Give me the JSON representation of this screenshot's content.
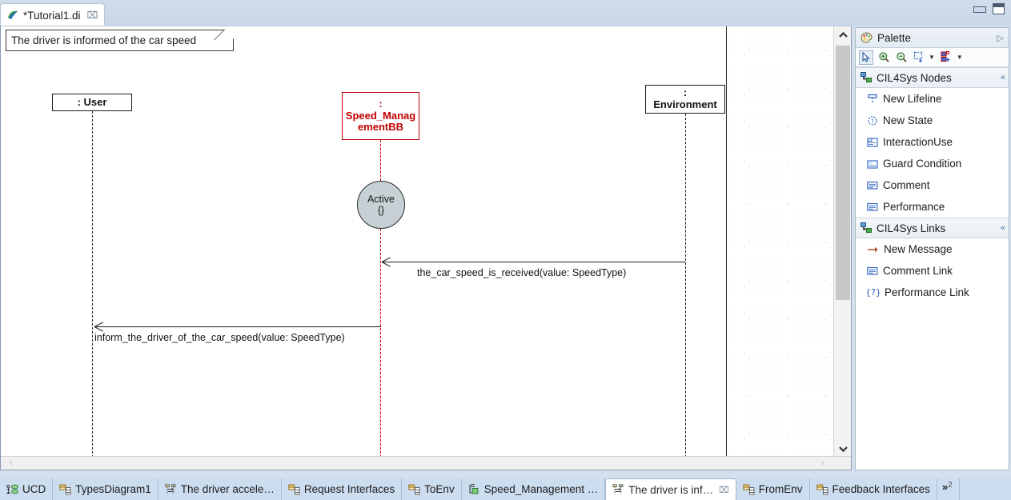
{
  "window": {
    "minimize_label": "Minimize",
    "maximize_label": "Maximize"
  },
  "editor_tab": {
    "title": "*Tutorial1.di",
    "close_glyph": "⌧",
    "icon": "papyrus-diagram-icon"
  },
  "diagram": {
    "note": {
      "text": "The driver is informed of the car speed"
    },
    "lifelines": [
      {
        "name": "user",
        "label": ": User",
        "color": "#1a1a1a"
      },
      {
        "name": "speed-management-bb",
        "label": ":\nSpeed_Manag\nementBB",
        "line1": ":",
        "line2": "Speed_Manag",
        "line3": "ementBB",
        "color": "#c00000"
      },
      {
        "name": "environment",
        "label": ":\nEnvironment",
        "line1": ":",
        "line2": "Environment",
        "color": "#1a1a1a"
      }
    ],
    "state": {
      "label": "Active",
      "sublabel": "{}"
    },
    "messages": [
      {
        "name": "the-car-speed-is-received",
        "label": "the_car_speed_is_received(value: SpeedType)",
        "direction": "right-to-left"
      },
      {
        "name": "inform-the-driver-of-the-car-speed",
        "label": "inform_the_driver_of_the_car_speed(value: SpeedType)",
        "direction": "right-to-left"
      }
    ]
  },
  "palette": {
    "title": "Palette",
    "collapse_glyph": "▷",
    "toolbar": [
      {
        "name": "select-tool",
        "icon": "arrow-cursor-icon",
        "selected": true
      },
      {
        "name": "zoom-in-tool",
        "icon": "zoom-in-icon",
        "selected": false
      },
      {
        "name": "zoom-out-tool",
        "icon": "zoom-out-icon",
        "selected": false
      },
      {
        "name": "marquee-tool",
        "icon": "marquee-select-icon",
        "selected": false,
        "has_dropdown": true
      },
      {
        "name": "format-tool",
        "icon": "node-create-icon",
        "selected": false,
        "has_dropdown": true
      }
    ],
    "groups": [
      {
        "name": "cil4sys-nodes",
        "label": "CIL4Sys Nodes",
        "icon": "group-nodes-icon",
        "pin_glyph": "«",
        "items": [
          {
            "name": "new-lifeline",
            "label": "New Lifeline",
            "icon": "lifeline-icon"
          },
          {
            "name": "new-state",
            "label": "New State",
            "icon": "state-icon"
          },
          {
            "name": "interaction-use",
            "label": "InteractionUse",
            "icon": "interaction-use-icon"
          },
          {
            "name": "guard-condition",
            "label": "Guard Condition",
            "icon": "guard-condition-icon"
          },
          {
            "name": "comment",
            "label": "Comment",
            "icon": "comment-icon"
          },
          {
            "name": "performance",
            "label": "Performance",
            "icon": "comment-icon"
          }
        ]
      },
      {
        "name": "cil4sys-links",
        "label": "CIL4Sys Links",
        "icon": "group-links-icon",
        "pin_glyph": "«",
        "items": [
          {
            "name": "new-message",
            "label": "New Message",
            "icon": "arrow-right-icon"
          },
          {
            "name": "comment-link",
            "label": "Comment Link",
            "icon": "comment-icon"
          },
          {
            "name": "performance-link",
            "label": "Performance Link",
            "icon": "brace-question-icon"
          }
        ]
      }
    ]
  },
  "bottom_tabs": {
    "items": [
      {
        "name": "tab-ucd",
        "label": "UCD",
        "icon": "usecase-diagram-icon",
        "active": false,
        "closable": false
      },
      {
        "name": "tab-typesdiagram1",
        "label": "TypesDiagram1",
        "icon": "class-diagram-icon",
        "active": false,
        "closable": false
      },
      {
        "name": "tab-the-driver-accelerates",
        "label": "The driver accele…",
        "icon": "sequence-diagram-icon",
        "active": false,
        "closable": false
      },
      {
        "name": "tab-request-interfaces",
        "label": "Request Interfaces",
        "icon": "class-diagram-icon",
        "active": false,
        "closable": false
      },
      {
        "name": "tab-toenv",
        "label": "ToEnv",
        "icon": "class-diagram-icon",
        "active": false,
        "closable": false
      },
      {
        "name": "tab-speed-management",
        "label": "Speed_Management …",
        "icon": "composite-diagram-icon",
        "active": false,
        "closable": false
      },
      {
        "name": "tab-the-driver-is-informed",
        "label": "The driver is inf…",
        "icon": "sequence-diagram-icon",
        "active": true,
        "closable": true,
        "close_glyph": "⌧"
      },
      {
        "name": "tab-fromenv",
        "label": "FromEnv",
        "icon": "class-diagram-icon",
        "active": false,
        "closable": false
      },
      {
        "name": "tab-feedback-interfaces",
        "label": "Feedback Interfaces",
        "icon": "class-diagram-icon",
        "active": false,
        "closable": false
      }
    ],
    "overflow": {
      "name": "tab-overflow",
      "glyph": "»",
      "count": "2"
    }
  },
  "scrollbars": {
    "vertical": {
      "up_glyph": "ⱏ",
      "down_glyph": "ⱟ"
    },
    "horizontal": {
      "left_glyph": "‹",
      "right_glyph": "›"
    }
  },
  "colors": {
    "accent_red": "#c00000",
    "tabbar_bg": "#cdddf0",
    "state_fill": "#c7d0d4"
  }
}
